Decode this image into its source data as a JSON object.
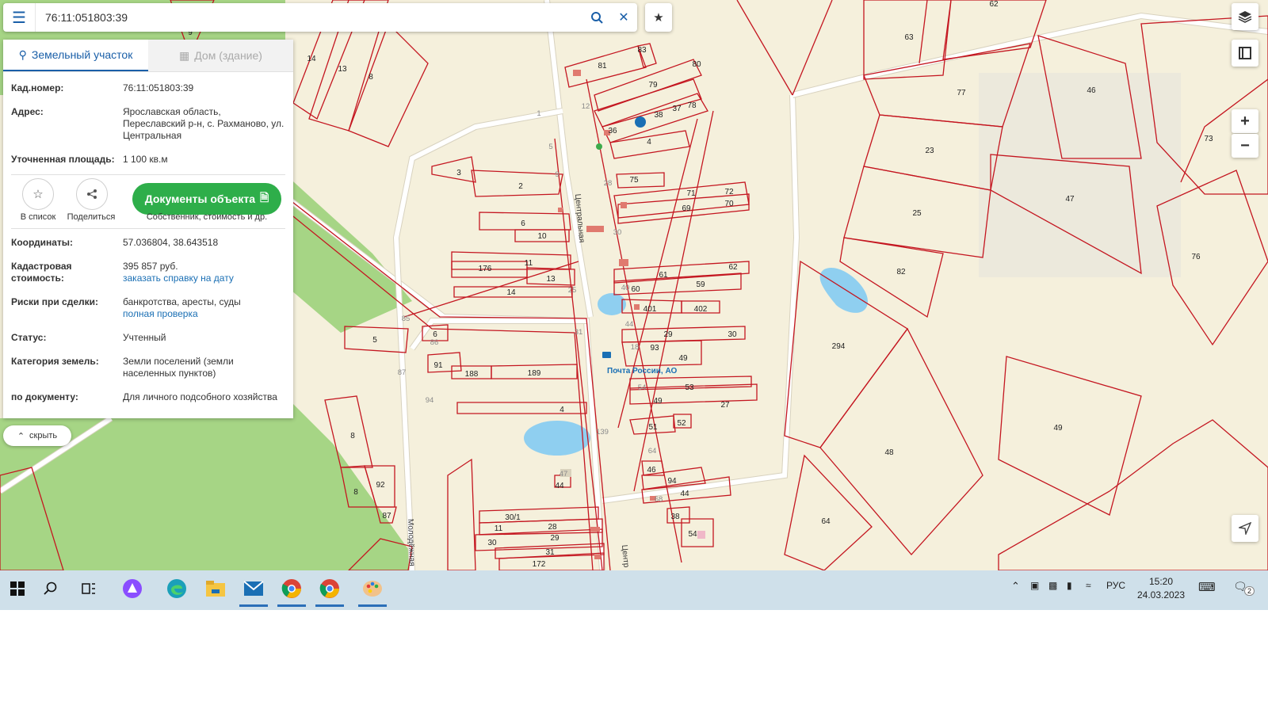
{
  "search": {
    "value": "76:11:051803:39"
  },
  "tabs": [
    {
      "label": "Земельный участок",
      "active": true
    },
    {
      "label": "Дом (здание)",
      "active": false
    }
  ],
  "info": {
    "cadastral_label": "Кад.номер:",
    "cadastral_value": "76:11:051803:39",
    "address_label": "Адрес:",
    "address_value": "Ярославская область, Переславский р-н, с. Рахманово, ул. Центральная",
    "area_label": "Уточненная площадь:",
    "area_value": "1 100 кв.м",
    "coords_label": "Координаты:",
    "coords_value": "57.036804, 38.643518",
    "cost_label": "Кадастровая стоимость:",
    "cost_value": "395 857 руб.",
    "cost_link": "заказать справку на дату",
    "risk_label": "Риски при сделки:",
    "risk_value": "банкротства, аресты, суды",
    "risk_link": "полная проверка",
    "status_label": "Статус:",
    "status_value": "Учтенный",
    "category_label": "Категория земель:",
    "category_value": "Земли поселений (земли населенных пунктов)",
    "doc_label": "по документу:",
    "doc_value": "Для личного подсобного хозяйства"
  },
  "actions": {
    "to_list": "В список",
    "share": "Поделиться",
    "documents": "Документы объекта",
    "documents_sub": "Собственник, стоимость и др."
  },
  "hide_label": "скрыть",
  "map": {
    "plot_labels": [
      "9",
      "14",
      "13",
      "8",
      "81",
      "83",
      "80",
      "79",
      "38",
      "37",
      "78",
      "36",
      "4",
      "63",
      "62",
      "77",
      "46",
      "23",
      "73",
      "3",
      "2",
      "75",
      "71",
      "72",
      "69",
      "70",
      "25",
      "47",
      "6",
      "10",
      "176",
      "11",
      "13",
      "14",
      "61",
      "62",
      "60",
      "59",
      "82",
      "76",
      "401",
      "402",
      "5",
      "6",
      "29",
      "30",
      "93",
      "49",
      "294",
      "91",
      "188",
      "189",
      "53",
      "49",
      "27",
      "4",
      "8",
      "51",
      "52",
      "48",
      "49",
      "8",
      "92",
      "87",
      "46",
      "94",
      "44",
      "38",
      "64",
      "30/1",
      "28",
      "11",
      "29",
      "30",
      "31",
      "172",
      "54",
      "44",
      "1",
      "12",
      "5",
      "9",
      "28",
      "30",
      "40",
      "44",
      "31",
      "18",
      "47",
      "54",
      "64",
      "68",
      "87",
      "94",
      "85",
      "86",
      "25",
      "139"
    ],
    "streets": [
      "Центральная",
      "Молодёжная",
      "Центр"
    ],
    "poi": "Почта России, АО",
    "colors": {
      "parcel": "#c41620",
      "forest": "#a6d585",
      "water": "#8fcff0",
      "background": "#f5f0dc"
    }
  },
  "taskbar": {
    "icons": [
      "windows-start-icon",
      "search-icon",
      "task-view-icon",
      "alice-icon",
      "edge-icon",
      "explorer-icon",
      "mail-icon",
      "chrome-icon",
      "chrome-icon",
      "paint-icon"
    ],
    "lang": "РУС",
    "time": "15:20",
    "date": "24.03.2023",
    "notifications": "2"
  }
}
